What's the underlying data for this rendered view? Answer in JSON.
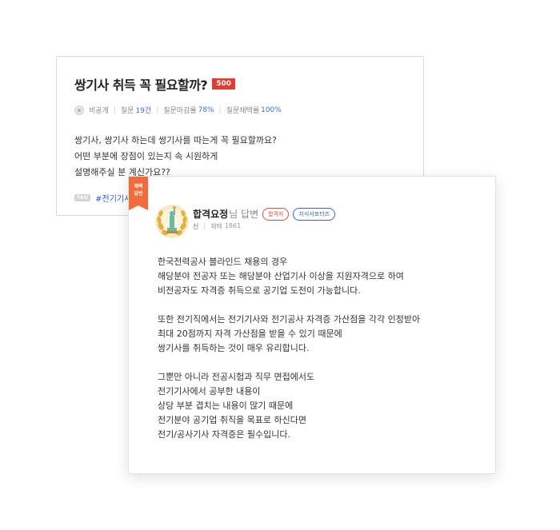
{
  "question": {
    "title": "쌍기사 취득 꼭 필요할까?",
    "points": "500",
    "author": "비공개",
    "stats": [
      {
        "label": "질문",
        "value": "19건"
      },
      {
        "label": "질문마감률",
        "value": "78%"
      },
      {
        "label": "질문채택률",
        "value": "100%"
      }
    ],
    "body": [
      "쌍기사, 쌍기사 하는데 쌍기사를 따는게 꼭 필요할까요?",
      "어떤 부분에 장점이 있는지 속 시원하게",
      "설명해주실 분 계신가요??"
    ],
    "tag_label": "TAG",
    "tag": "#전기기사"
  },
  "answer": {
    "ribbon": [
      "채택",
      "답변"
    ],
    "name": "합격요정",
    "name_suffix": "님 답변",
    "badge_pass": "합격자",
    "badge_supporter": "지식서포터즈",
    "grade": "신",
    "adopt_label": "채택",
    "adopt_count": "1861",
    "paragraphs": [
      [
        "한국전력공사 블라인드 채용의 경우",
        "해당분야 전공자 또는 해당분야 산업기사 이상을 지원자격으로 하여",
        "비전공자도 자격증 취득으로 공기업 도전이 가능합니다."
      ],
      [
        "또한 전기직에서는 전기기사와 전기공사 자격증 가산점을 각각 인정받아",
        "최대 20점까지 자격 가산점을 받을 수 있기 때문에",
        "쌍기사를 취득하는 것이 매우 유리합니다."
      ],
      [
        "그뿐만 아니라 전공시험과 직무 면접에서도",
        "전기기사에서 공부한 내용이",
        "상당 부분 겹치는 내용이 많기 때문에",
        "전기분야 공기업 취직을 목표로 하신다면",
        "전기/공사기사 자격증은 필수입니다."
      ]
    ]
  },
  "colors": {
    "accent_red": "#e63b2e",
    "ribbon_orange": "#f26b3a",
    "link_blue": "#2a5bd7",
    "badge_blue": "#3b5fd4"
  },
  "icons": {
    "avatar_small": "default-user-icon",
    "avatar_large": "statue-of-liberty-laurel-icon"
  }
}
